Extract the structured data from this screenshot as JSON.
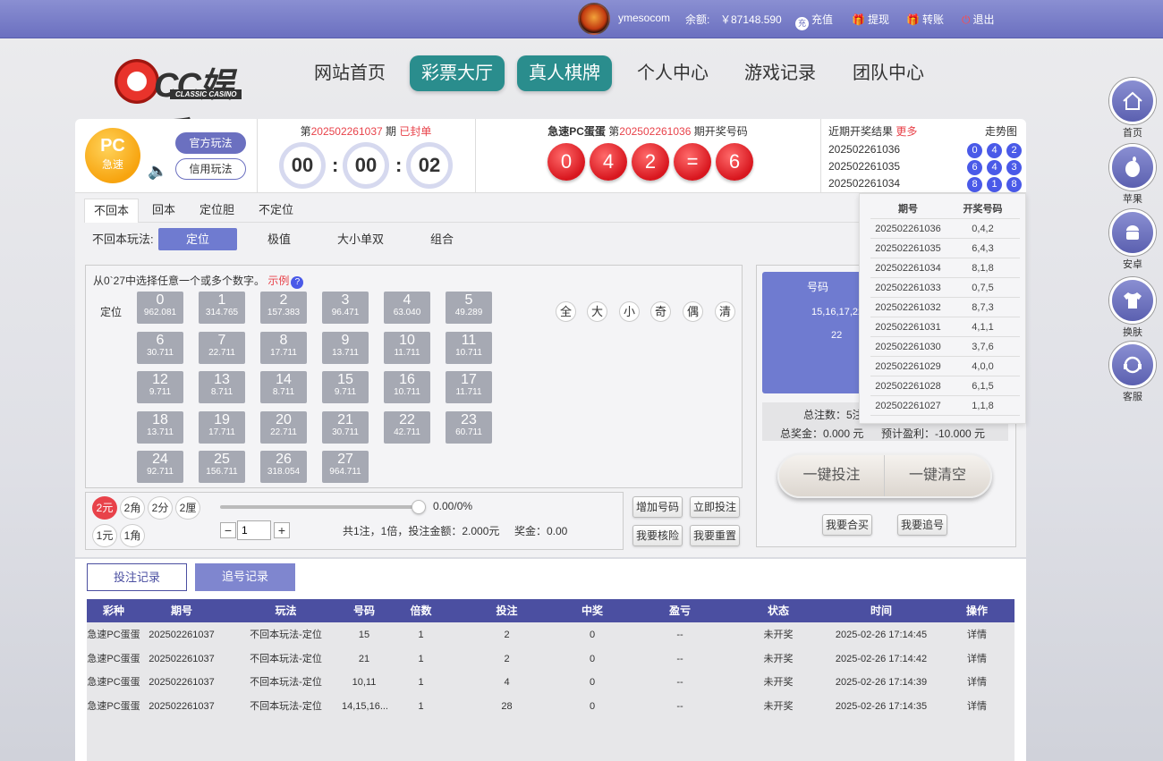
{
  "topbar": {
    "username": "ymesocom",
    "balance_label": "余额:",
    "balance": "￥87148.590",
    "recharge_icon": "充",
    "recharge": "充值",
    "withdraw": "提现",
    "transfer": "转账",
    "logout": "退出"
  },
  "logo": {
    "text": "CC娱乐",
    "sub": "CLASSIC CASINO"
  },
  "nav": [
    "网站首页",
    "彩票大厅",
    "真人棋牌",
    "个人中心",
    "游戏记录",
    "团队中心"
  ],
  "side": [
    "首页",
    "苹果",
    "安卓",
    "换肤",
    "客服"
  ],
  "game": {
    "icon_top": "PC",
    "icon_bottom": "急速",
    "mode_official": "官方玩法",
    "mode_credit": "信用玩法"
  },
  "issue": {
    "prefix": "第",
    "number": "202502261037",
    "suffix": "期",
    "status": "已封单",
    "countdown": [
      "00",
      "00",
      "02"
    ]
  },
  "result": {
    "title": "急速PC蛋蛋",
    "prefix": "第",
    "number": "202502261036",
    "suffix": "期开奖号码",
    "balls": [
      "0",
      "4",
      "2",
      "=",
      "6"
    ]
  },
  "recent": {
    "title": "近期开奖结果",
    "more": "更多",
    "trend": "走势图",
    "rows": [
      {
        "issue": "202502261036",
        "balls": [
          "0",
          "4",
          "2"
        ]
      },
      {
        "issue": "202502261035",
        "balls": [
          "6",
          "4",
          "3"
        ]
      },
      {
        "issue": "202502261034",
        "balls": [
          "8",
          "1",
          "8"
        ]
      }
    ]
  },
  "popup": {
    "h_issue": "期号",
    "h_code": "开奖号码",
    "rows": [
      [
        "202502261036",
        "0,4,2"
      ],
      [
        "202502261035",
        "6,4,3"
      ],
      [
        "202502261034",
        "8,1,8"
      ],
      [
        "202502261033",
        "0,7,5"
      ],
      [
        "202502261032",
        "8,7,3"
      ],
      [
        "202502261031",
        "4,1,1"
      ],
      [
        "202502261030",
        "3,7,6"
      ],
      [
        "202502261029",
        "4,0,0"
      ],
      [
        "202502261028",
        "6,1,5"
      ],
      [
        "202502261027",
        "1,1,8"
      ]
    ]
  },
  "tabs": [
    "不回本",
    "回本",
    "定位胆",
    "不定位"
  ],
  "subtabs": {
    "label": "不回本玩法:",
    "items": [
      "定位",
      "极值",
      "大小单双",
      "组合"
    ]
  },
  "numbers": {
    "hint": "从0`27中选择任意一个或多个数字。",
    "example": "示例",
    "help": "?",
    "row_label": "定位",
    "items": [
      [
        "0",
        "962.081"
      ],
      [
        "1",
        "314.765"
      ],
      [
        "2",
        "157.383"
      ],
      [
        "3",
        "96.471"
      ],
      [
        "4",
        "63.040"
      ],
      [
        "5",
        "49.289"
      ],
      [
        "6",
        "30.711"
      ],
      [
        "7",
        "22.711"
      ],
      [
        "8",
        "17.711"
      ],
      [
        "9",
        "13.711"
      ],
      [
        "10",
        "11.711"
      ],
      [
        "11",
        "10.711"
      ],
      [
        "12",
        "9.711"
      ],
      [
        "13",
        "8.711"
      ],
      [
        "14",
        "8.711"
      ],
      [
        "15",
        "9.711"
      ],
      [
        "16",
        "10.711"
      ],
      [
        "17",
        "11.711"
      ],
      [
        "18",
        "13.711"
      ],
      [
        "19",
        "17.711"
      ],
      [
        "20",
        "22.711"
      ],
      [
        "21",
        "30.711"
      ],
      [
        "22",
        "42.711"
      ],
      [
        "23",
        "60.711"
      ],
      [
        "24",
        "92.711"
      ],
      [
        "25",
        "156.711"
      ],
      [
        "26",
        "318.054"
      ],
      [
        "27",
        "964.711"
      ]
    ],
    "quick": [
      "全",
      "大",
      "小",
      "奇",
      "偶",
      "清"
    ]
  },
  "bet": {
    "units": [
      "2元",
      "2角",
      "2分",
      "2厘",
      "1元",
      "1角"
    ],
    "slider_value": 0,
    "rebate": "0.00/0%",
    "multiplier": "1",
    "minus": "−",
    "plus": "+",
    "summary": "共1注，1倍，投注金额：2.000元",
    "prize": "奖金：0.00",
    "btn_add": "增加号码",
    "btn_bet": "立即投注",
    "btn_check": "我要核险",
    "btn_reset": "我要重置"
  },
  "cart": {
    "col": "号码",
    "item1": "15,16,17,22",
    "item2": "22",
    "total_label": "总注数：5注",
    "award": "总奖金：0.000 元",
    "profit": "预计盈利：-10.000 元",
    "btn_bet": "一键投注",
    "btn_clear": "一键清空",
    "btn_joint": "我要合买",
    "btn_chase": "我要追号"
  },
  "records": {
    "tab_bet": "投注记录",
    "tab_chase": "追号记录",
    "headers": [
      "彩种",
      "期号",
      "玩法",
      "号码",
      "倍数",
      "投注",
      "中奖",
      "盈亏",
      "状态",
      "时间",
      "操作"
    ],
    "rows": [
      [
        "急速PC蛋蛋",
        "202502261037",
        "不回本玩法-定位",
        "15",
        "1",
        "2",
        "0",
        "--",
        "未开奖",
        "2025-02-26 17:14:45",
        "详情"
      ],
      [
        "急速PC蛋蛋",
        "202502261037",
        "不回本玩法-定位",
        "21",
        "1",
        "2",
        "0",
        "--",
        "未开奖",
        "2025-02-26 17:14:42",
        "详情"
      ],
      [
        "急速PC蛋蛋",
        "202502261037",
        "不回本玩法-定位",
        "10,11",
        "1",
        "4",
        "0",
        "--",
        "未开奖",
        "2025-02-26 17:14:39",
        "详情"
      ],
      [
        "急速PC蛋蛋",
        "202502261037",
        "不回本玩法-定位",
        "14,15,16...",
        "1",
        "28",
        "0",
        "--",
        "未开奖",
        "2025-02-26 17:14:35",
        "详情"
      ]
    ]
  },
  "colors": {
    "accent": "#6b70c0",
    "teal": "#2a8d8d",
    "red": "#e8424a",
    "header": "#4b4fa1"
  }
}
